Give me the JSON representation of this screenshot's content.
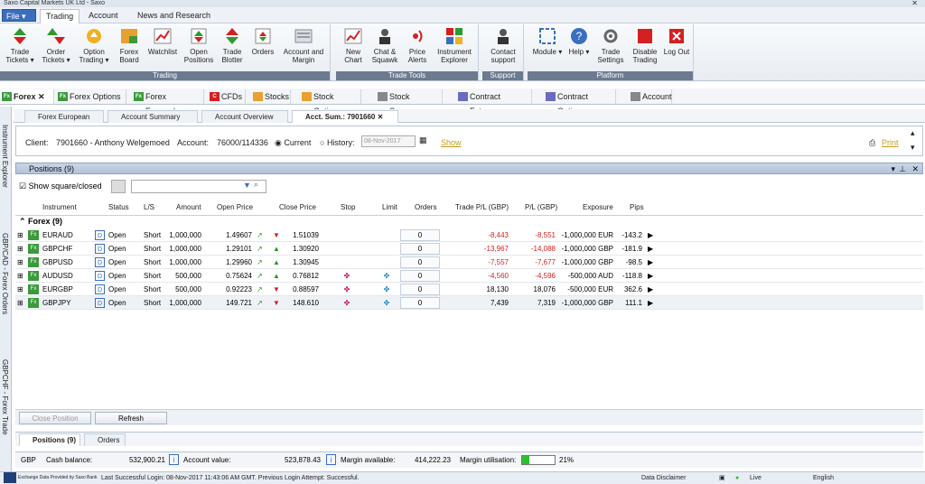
{
  "window": {
    "title": "Saxo Capital Markets UK Ltd - Saxo"
  },
  "menu": {
    "file": "File",
    "tabs": [
      "Trading",
      "Account",
      "News and Research"
    ],
    "active": "Trading"
  },
  "ribbon": {
    "groups": [
      {
        "caption": "Trading",
        "buttons": [
          "Trade Tickets",
          "Order Tickets",
          "Option Trading",
          "Forex Board",
          "Watchlist",
          "Open Positions",
          "Trade Blotter",
          "Orders",
          "Account and Margin"
        ]
      },
      {
        "caption": "Trade Tools",
        "buttons": [
          "New Chart",
          "Chat & Squawk",
          "Price Alerts",
          "Instrument Explorer"
        ]
      },
      {
        "caption": "Support",
        "buttons": [
          "Contact support"
        ]
      },
      {
        "caption": "Platform",
        "buttons": [
          "Module",
          "Help",
          "Trade Settings",
          "Disable Trading",
          "Log Out"
        ]
      }
    ]
  },
  "main_tabs": [
    "Forex",
    "Forex Options",
    "Forex Forwards",
    "CFDs",
    "Stocks",
    "Stock Options",
    "Stock Screener",
    "Contract Futures",
    "Contract Options",
    "Account"
  ],
  "sidebar": [
    "Instrument Explorer",
    "GBP/CAD - Forex Orders",
    "GBPCHF - Forex Trade"
  ],
  "sub_tabs": [
    "Forex European",
    "Account Summary",
    "Account Overview",
    "Acct. Sum.: 7901660"
  ],
  "client": {
    "client_label": "Client:",
    "client_value": "7901660 - Anthony Welgemoed",
    "account_label": "Account:",
    "account_value": "76000/114336",
    "current": "Current",
    "history": "History:",
    "history_date": "08-Nov-2017",
    "show": "Show",
    "print": "Print"
  },
  "positions_panel": {
    "title": "Positions (9)",
    "show_closed": "Show square/closed"
  },
  "table": {
    "headers": [
      "Instrument",
      "Status",
      "L/S",
      "Amount",
      "Open Price",
      "Close Price",
      "Stop",
      "Limit",
      "Orders",
      "Trade P/L (GBP)",
      "P/L (GBP)",
      "Exposure",
      "Pips"
    ],
    "group": "Forex (9)",
    "rows": [
      {
        "instrument": "EURAUD",
        "status": "Open",
        "ls": "Short",
        "amount": "1,000,000",
        "open": "1.49607",
        "close": "1.51039",
        "dir": "down",
        "orders": "0",
        "tpl": "-8,443",
        "pl": "-8,551",
        "exposure": "-1,000,000 EUR",
        "pips": "-143.2",
        "neg": true,
        "sl": false
      },
      {
        "instrument": "GBPCHF",
        "status": "Open",
        "ls": "Short",
        "amount": "1,000,000",
        "open": "1.29101",
        "close": "1.30920",
        "dir": "up",
        "orders": "0",
        "tpl": "-13,967",
        "pl": "-14,088",
        "exposure": "-1,000,000 GBP",
        "pips": "-181.9",
        "neg": true,
        "sl": false
      },
      {
        "instrument": "GBPUSD",
        "status": "Open",
        "ls": "Short",
        "amount": "1,000,000",
        "open": "1.29960",
        "close": "1.30945",
        "dir": "up",
        "orders": "0",
        "tpl": "-7,557",
        "pl": "-7,677",
        "exposure": "-1,000,000 GBP",
        "pips": "-98.5",
        "neg": true,
        "sl": false
      },
      {
        "instrument": "AUDUSD",
        "status": "Open",
        "ls": "Short",
        "amount": "500,000",
        "open": "0.75624",
        "close": "0.76812",
        "dir": "up",
        "orders": "0",
        "tpl": "-4,560",
        "pl": "-4,596",
        "exposure": "-500,000 AUD",
        "pips": "-118.8",
        "neg": true,
        "sl": true
      },
      {
        "instrument": "EURGBP",
        "status": "Open",
        "ls": "Short",
        "amount": "500,000",
        "open": "0.92223",
        "close": "0.88597",
        "dir": "down",
        "orders": "0",
        "tpl": "18,130",
        "pl": "18,076",
        "exposure": "-500,000 EUR",
        "pips": "362.6",
        "neg": false,
        "sl": true
      },
      {
        "instrument": "GBPJPY",
        "status": "Open",
        "ls": "Short",
        "amount": "1,000,000",
        "open": "149.721",
        "close": "148.610",
        "dir": "down",
        "orders": "0",
        "tpl": "7,439",
        "pl": "7,319",
        "exposure": "-1,000,000 GBP",
        "pips": "111.1",
        "neg": false,
        "sl": true
      }
    ]
  },
  "buttons": {
    "close_position": "Close Position",
    "refresh": "Refresh"
  },
  "bottom_tabs": [
    "Positions (9)",
    "Orders"
  ],
  "status": {
    "currency": "GBP",
    "cash_label": "Cash balance:",
    "cash_value": "532,900.21",
    "account_label": "Account value:",
    "account_value": "523,878.43",
    "margin_label": "Margin available:",
    "margin_value": "414,222.23",
    "util_label": "Margin utilisation:",
    "util_value": "21%",
    "util_fraction": 0.21
  },
  "footer": {
    "exchange": "Exchange Data Provided by Saxo Bank",
    "login": "Last Successful Login: 08-Nov-2017 11:43:06 AM GMT. Previous Login Attempt: Successful.",
    "disclaimer": "Data Disclaimer",
    "live": "Live",
    "language": "English"
  }
}
